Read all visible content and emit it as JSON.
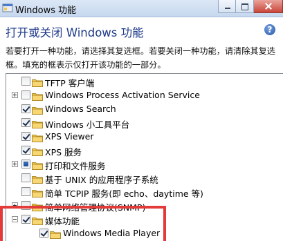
{
  "window": {
    "title": "Windows 功能"
  },
  "header": {
    "title": "打开或关闭 Windows 功能",
    "description": "若要打开一种功能，请选择其复选框。若要关闭一种功能，请清除其复选框。填充的框表示仅打开该功能的一部分。"
  },
  "features": [
    {
      "label": "TFTP 客户端",
      "state": "unchecked",
      "expandable": false
    },
    {
      "label": "Windows Process Activation Service",
      "state": "unchecked",
      "expandable": true
    },
    {
      "label": "Windows Search",
      "state": "checked",
      "expandable": false
    },
    {
      "label": "Windows 小工具平台",
      "state": "checked",
      "expandable": false
    },
    {
      "label": "XPS Viewer",
      "state": "checked",
      "expandable": false
    },
    {
      "label": "XPS 服务",
      "state": "checked",
      "expandable": false
    },
    {
      "label": "打印和文件服务",
      "state": "partial",
      "expandable": true
    },
    {
      "label": "基于 UNIX 的应用程序子系统",
      "state": "unchecked",
      "expandable": false
    },
    {
      "label": "简单 TCPIP 服务(即 echo、daytime 等)",
      "state": "unchecked",
      "expandable": false
    },
    {
      "label": "简单网络管理协议(SNMP)",
      "state": "unchecked",
      "expandable": true
    },
    {
      "label": "媒体功能",
      "state": "checked",
      "expandable": true,
      "expanded": true
    },
    {
      "label": "Windows Media Player",
      "state": "checked",
      "expandable": false,
      "child": true
    }
  ],
  "colors": {
    "title_blue": "#1e3a8a",
    "highlight_red": "#e33a3a",
    "folder_yellow": "#f2c94c"
  }
}
